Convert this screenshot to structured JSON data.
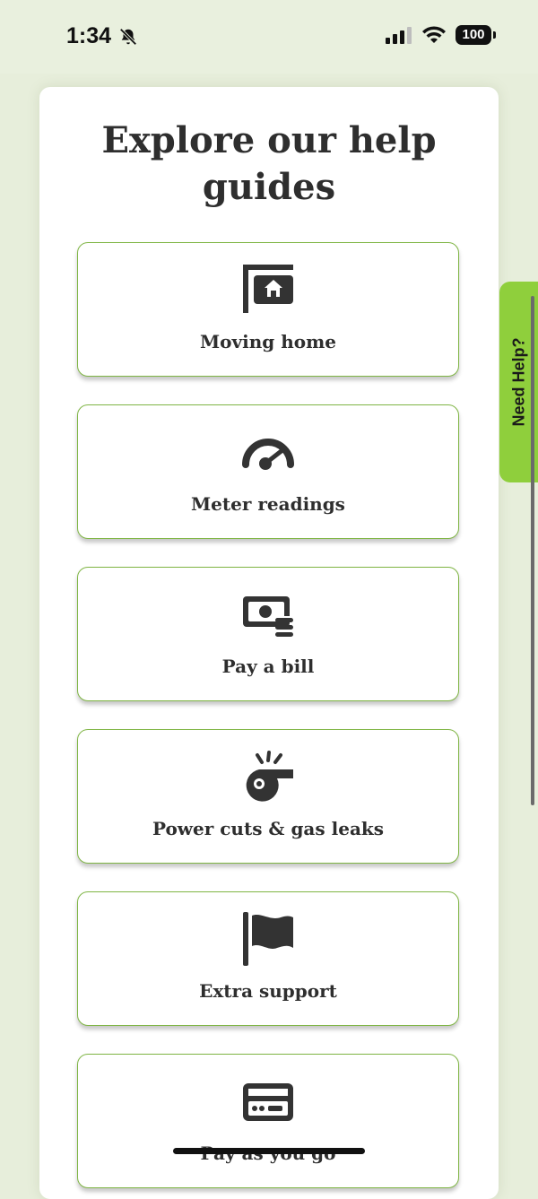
{
  "status_bar": {
    "time": "1:34",
    "battery": "100"
  },
  "page": {
    "title": "Explore our help guides"
  },
  "guides": [
    {
      "label": "Moving home",
      "icon": "house-sign-icon"
    },
    {
      "label": "Meter readings",
      "icon": "gauge-icon"
    },
    {
      "label": "Pay a bill",
      "icon": "money-bill-icon"
    },
    {
      "label": "Power cuts & gas leaks",
      "icon": "whistle-icon"
    },
    {
      "label": "Extra support",
      "icon": "flag-icon"
    },
    {
      "label": "Pay as you go",
      "icon": "credit-card-icon"
    }
  ],
  "need_help": {
    "label": "Need Help?"
  },
  "colors": {
    "background": "#e7eedb",
    "accent_green": "#8fcf3c",
    "card_border": "#7fb544",
    "text": "#2e2e2e"
  }
}
